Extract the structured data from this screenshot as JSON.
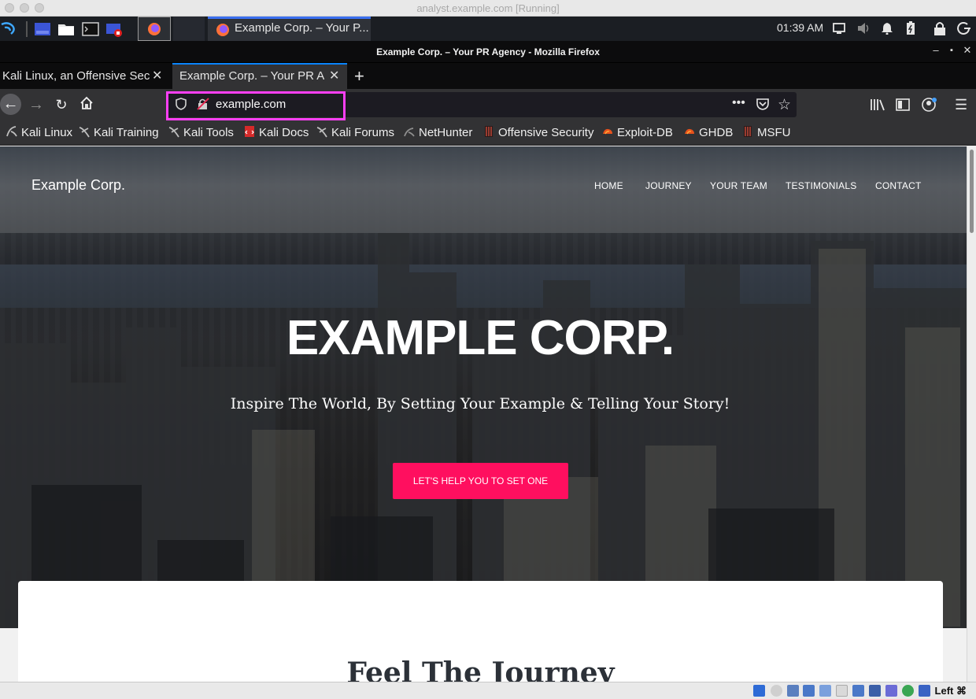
{
  "vm_window": {
    "title": "analyst.example.com [Running]"
  },
  "panel": {
    "clock": "01:39 AM",
    "active_task": "Example Corp. – Your P..."
  },
  "firefox": {
    "window_title": "Example Corp. – Your PR Agency - Mozilla Firefox",
    "tabs": [
      {
        "label": "Kali Linux, an Offensive Secu",
        "active": false
      },
      {
        "label": "Example Corp. – Your PR Ag",
        "active": true
      }
    ],
    "url": "example.com",
    "bookmarks": [
      {
        "label": "Kali Linux",
        "icon": "kali-dragon-icon"
      },
      {
        "label": "Kali Training",
        "icon": "kali-dragon-icon"
      },
      {
        "label": "Kali Tools",
        "icon": "kali-dragon-icon"
      },
      {
        "label": "Kali Docs",
        "icon": "kali-docs-icon"
      },
      {
        "label": "Kali Forums",
        "icon": "kali-dragon-icon"
      },
      {
        "label": "NetHunter",
        "icon": "kali-dragon-icon"
      },
      {
        "label": "Offensive Security",
        "icon": "offsec-icon"
      },
      {
        "label": "Exploit-DB",
        "icon": "exploitdb-icon"
      },
      {
        "label": "GHDB",
        "icon": "ghdb-icon"
      },
      {
        "label": "MSFU",
        "icon": "offsec-icon"
      }
    ],
    "highlight_color": "#ff3ff6"
  },
  "site": {
    "brand": "Example Corp.",
    "nav": [
      "HOME",
      "JOURNEY",
      "YOUR TEAM",
      "TESTIMONIALS",
      "CONTACT"
    ],
    "hero_title": "EXAMPLE CORP.",
    "hero_subtitle": "Inspire The World, By Setting Your Example & Telling Your Story!",
    "cta_label": "LET'S HELP YOU TO SET ONE",
    "cta_color": "#ff0f5f",
    "section_title": "Feel The Journey"
  },
  "vbox_status": {
    "host_key": "Left ⌘"
  }
}
